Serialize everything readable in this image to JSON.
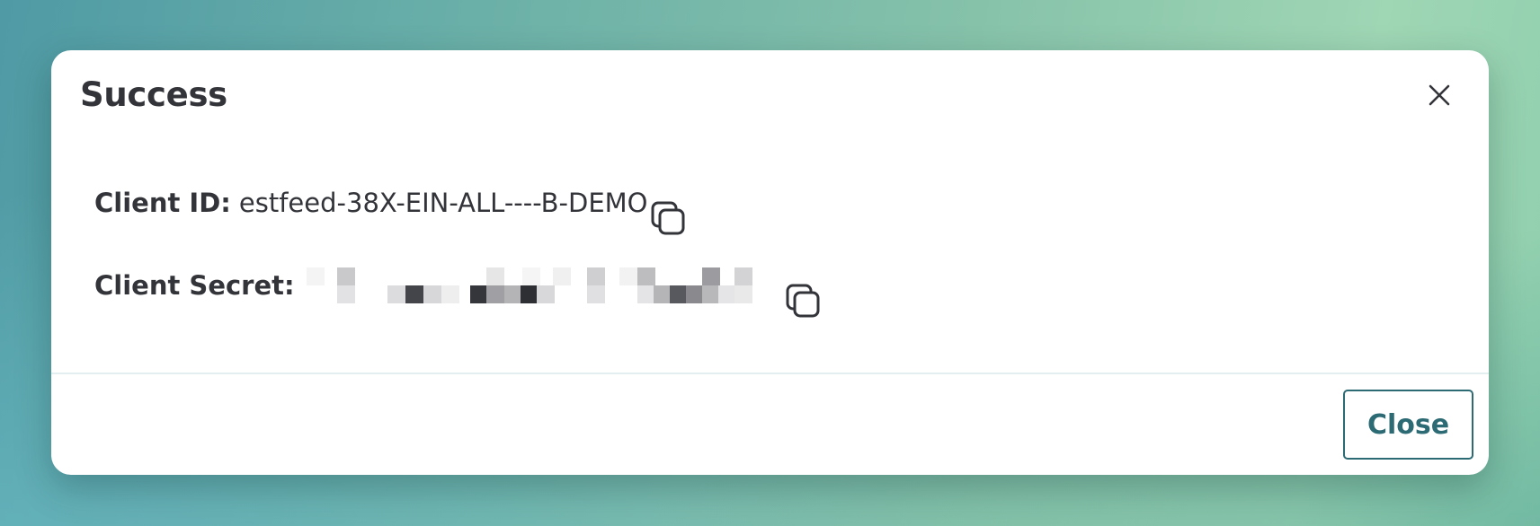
{
  "modal": {
    "title": "Success",
    "close_icon": "close-icon",
    "client_id": {
      "label": "Client ID:",
      "value": "estfeed-38X-EIN-ALL----B-DEMO",
      "copy_icon": "copy-icon"
    },
    "client_secret": {
      "label": "Client Secret:",
      "value_masked": true,
      "copy_icon": "copy-icon"
    },
    "footer": {
      "close_label": "Close"
    }
  },
  "colors": {
    "primary": "#2c6a74",
    "text": "#33343a",
    "divider": "#e3eef0"
  }
}
